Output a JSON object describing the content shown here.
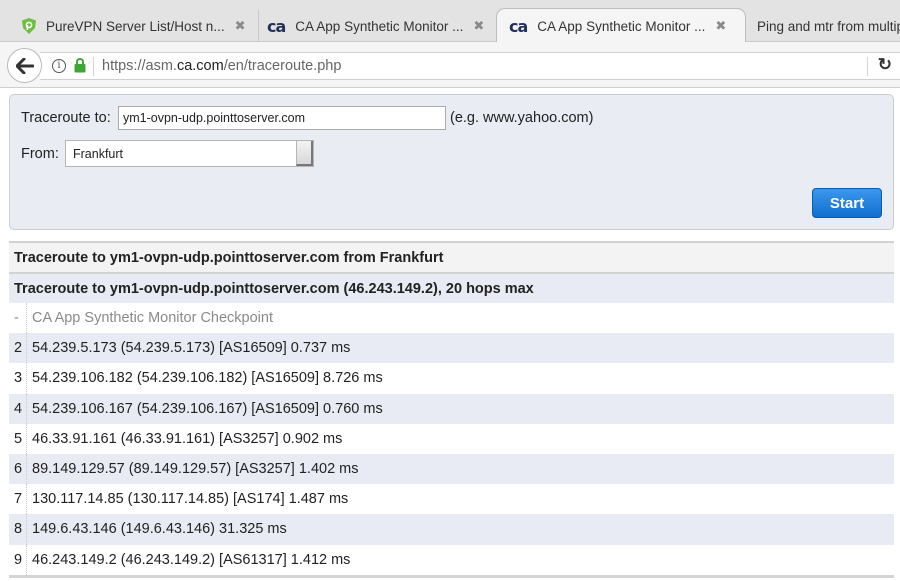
{
  "browser": {
    "tabs": [
      {
        "label": "PureVPN Server List/Host n...",
        "favicon": "purevpn-icon",
        "active": false
      },
      {
        "label": "CA App Synthetic Monitor ...",
        "favicon": "ca-logo-icon",
        "active": false
      },
      {
        "label": "CA App Synthetic Monitor ...",
        "favicon": "ca-logo-icon",
        "active": true
      },
      {
        "label": "Ping and mtr from multip",
        "favicon": null,
        "active": false
      }
    ],
    "favicon_ca_text": "ca",
    "url_prefix": "https://asm.",
    "url_domain": "ca.com",
    "url_suffix": "/en/traceroute.php",
    "close_glyph": "✖",
    "back_glyph": "🡐",
    "reload_glyph": "↻",
    "info_glyph": "i"
  },
  "form": {
    "traceroute_label": "Traceroute to:",
    "traceroute_value": "ym1-ovpn-udp.pointtoserver.com",
    "hint": "(e.g. www.yahoo.com)",
    "from_label": "From:",
    "from_value": "Frankfurt",
    "start_label": "Start"
  },
  "results": {
    "header1": "Traceroute to ym1-ovpn-udp.pointtoserver.com from Frankfurt",
    "header2": "Traceroute to ym1-ovpn-udp.pointtoserver.com (46.243.149.2), 20 hops max",
    "rows": [
      {
        "hop": "-",
        "text": "CA App Synthetic Monitor Checkpoint"
      },
      {
        "hop": "2",
        "text": "54.239.5.173 (54.239.5.173) [AS16509] 0.737 ms"
      },
      {
        "hop": "3",
        "text": "54.239.106.182 (54.239.106.182) [AS16509] 8.726 ms"
      },
      {
        "hop": "4",
        "text": "54.239.106.167 (54.239.106.167) [AS16509] 0.760 ms"
      },
      {
        "hop": "5",
        "text": "46.33.91.161 (46.33.91.161) [AS3257] 0.902 ms"
      },
      {
        "hop": "6",
        "text": "89.149.129.57 (89.149.129.57) [AS3257] 1.402 ms"
      },
      {
        "hop": "7",
        "text": "130.117.14.85 (130.117.14.85) [AS174] 1.487 ms"
      },
      {
        "hop": "8",
        "text": "149.6.43.146 (149.6.43.146) 31.325 ms"
      },
      {
        "hop": "9",
        "text": "46.243.149.2 (46.243.149.2) [AS61317] 1.412 ms"
      }
    ]
  },
  "colors": {
    "accent_button": "#1a7ad9",
    "panel_bg": "#e9ecf3",
    "row_alt_bg": "#e8ebf3",
    "lock_green": "#3fa535",
    "purevpn_green": "#6cbf3f"
  }
}
